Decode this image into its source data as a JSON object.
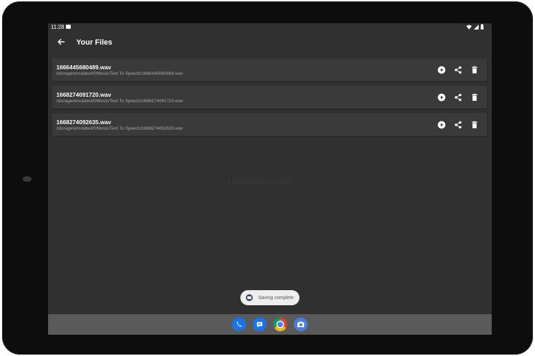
{
  "status_bar": {
    "time": "11:28"
  },
  "app_bar": {
    "title": "Your Files"
  },
  "files": [
    {
      "name": "1666445680489.wav",
      "path": "/storage/emulated/0/Music/Text To Speech/1666445680489.wav"
    },
    {
      "name": "1668274091720.wav",
      "path": "/storage/emulated/0/Music/Text To Speech/1668274091720.wav"
    },
    {
      "name": "1668274092635.wav",
      "path": "/storage/emulated/0/Music/Text To Speech/1668274092635.wav"
    }
  ],
  "watermark": "Uptodown.com",
  "toast": {
    "text": "Saving complete"
  },
  "dock": {
    "apps": [
      "phone-icon",
      "messages-icon",
      "chrome-icon",
      "camera-icon"
    ]
  },
  "colors": {
    "screen_bg": "#303030",
    "card_bg": "#3a3a3a",
    "dock_bg": "#5a5a5a",
    "bezel": "#0d0d0d"
  }
}
